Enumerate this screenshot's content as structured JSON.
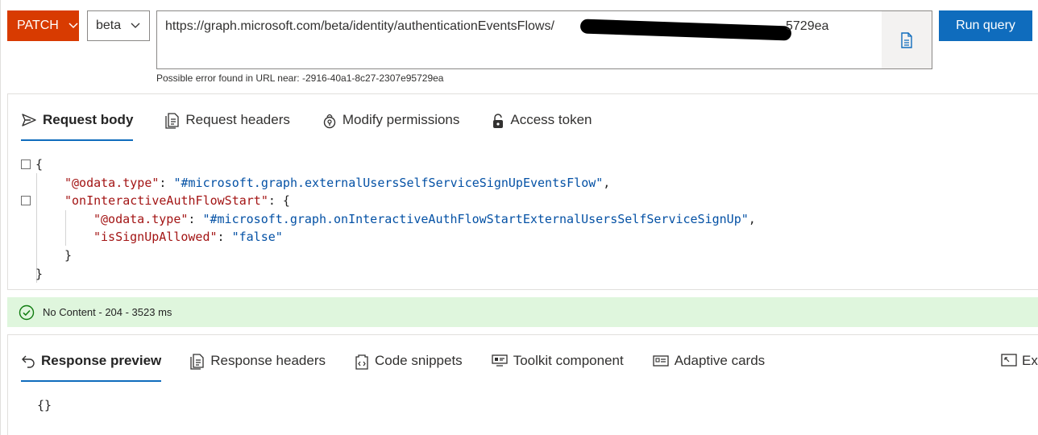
{
  "query": {
    "method": "PATCH",
    "version": "beta",
    "url_visible_start": "https://graph.microsoft.com/beta/identity/authenticationEventsFlows/",
    "url_visible_end": "5729ea",
    "url_error": "Possible error found in URL near: -2916-40a1-8c27-2307e95729ea",
    "run_label": "Run query"
  },
  "request_tabs": [
    {
      "label": "Request body",
      "icon": "send-icon",
      "active": true
    },
    {
      "label": "Request headers",
      "icon": "headers-document-icon",
      "active": false
    },
    {
      "label": "Modify permissions",
      "icon": "permissions-icon",
      "active": false
    },
    {
      "label": "Access token",
      "icon": "lock-icon",
      "active": false
    }
  ],
  "request_body": {
    "open_brace": "{",
    "k1": "\"@odata.type\"",
    "v1": "\"#microsoft.graph.externalUsersSelfServiceSignUpEventsFlow\"",
    "k2": "\"onInteractiveAuthFlowStart\"",
    "k3": "\"@odata.type\"",
    "v3": "\"#microsoft.graph.onInteractiveAuthFlowStartExternalUsersSelfServiceSignUp\"",
    "k4": "\"isSignUpAllowed\"",
    "v4": "\"false\"",
    "inner_close": "}",
    "outer_close": "}"
  },
  "status": {
    "text": "No Content - 204 - 3523 ms",
    "color": "#dff6dd"
  },
  "response_tabs": [
    {
      "label": "Response preview",
      "icon": "undo-arrow-icon",
      "active": true
    },
    {
      "label": "Response headers",
      "icon": "headers-document-icon",
      "active": false
    },
    {
      "label": "Code snippets",
      "icon": "code-snippet-icon",
      "active": false
    },
    {
      "label": "Toolkit component",
      "icon": "toolkit-icon",
      "active": false
    },
    {
      "label": "Adaptive cards",
      "icon": "card-icon",
      "active": false
    },
    {
      "label": "Exp",
      "icon": "expand-icon",
      "active": false
    }
  ],
  "response_body": "{}",
  "colors": {
    "method_bg": "#d83b01",
    "primary": "#0f6cbd",
    "json_key": "#a31515",
    "json_string": "#0451a5"
  }
}
